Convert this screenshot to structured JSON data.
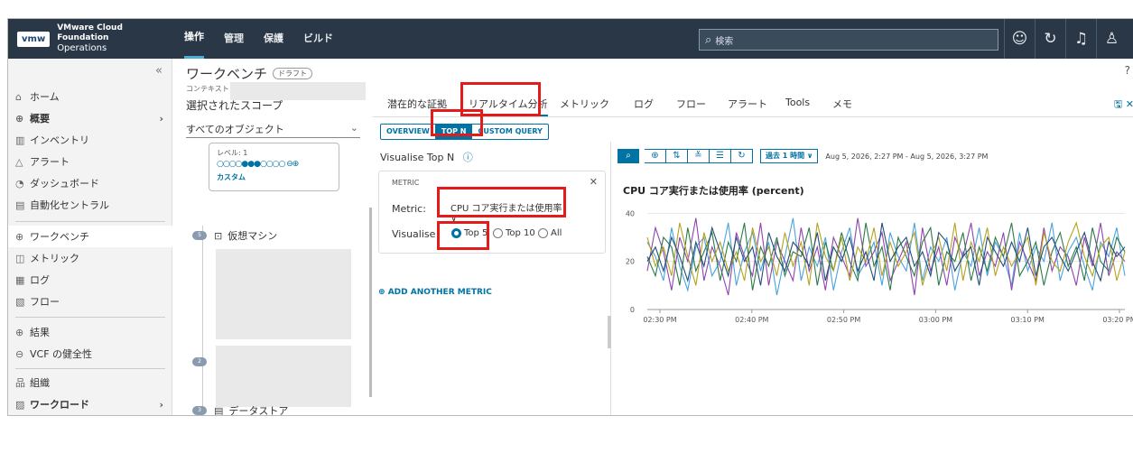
{
  "brand": {
    "logo": "vmw",
    "line1": "VMware Cloud Foundation",
    "line2": "Operations"
  },
  "topnav": [
    "操作",
    "管理",
    "保護",
    "ビルド"
  ],
  "search": {
    "placeholder": "検索"
  },
  "header_icons": [
    "smiley-icon",
    "refresh-icon",
    "bell-icon",
    "user-icon"
  ],
  "sidebar": {
    "collapse": "«",
    "items": [
      {
        "label": "ホーム",
        "icon": "⌂"
      },
      {
        "label": "概要",
        "icon": "⊕",
        "chev": "›"
      },
      {
        "label": "インベントリ",
        "icon": "▥"
      },
      {
        "label": "アラート",
        "icon": "△"
      },
      {
        "label": "ダッシュボード",
        "icon": "◔"
      },
      {
        "label": "自動化セントラル",
        "icon": "▤"
      },
      {
        "label": "ワークベンチ",
        "icon": "⊕"
      },
      {
        "label": "メトリック",
        "icon": "◫"
      },
      {
        "label": "ログ",
        "icon": "▦"
      },
      {
        "label": "フロー",
        "icon": "▧"
      },
      {
        "label": "結果",
        "icon": "⊕"
      },
      {
        "label": "VCF の健全性",
        "icon": "⊖"
      },
      {
        "label": "組織",
        "icon": "品"
      },
      {
        "label": "ワークロード",
        "icon": "▨",
        "chev": "›"
      }
    ]
  },
  "panel": {
    "title": "ワークベンチ",
    "draft": "ドラフト",
    "context_label": "コンテキスト",
    "scope_label": "選択されたスコープ",
    "all_objects": "すべてのオブジェクト",
    "level": "レベル: 1",
    "level_dots": "○○○○●●●○○○○ ⊖⊕",
    "custom": "カスタム",
    "tree": [
      {
        "badge": "5",
        "label": "仮想マシン",
        "icon": "⊡"
      },
      {
        "badge": "2",
        "label": "",
        "icon": ""
      },
      {
        "badge": "3",
        "label": "データストア",
        "icon": "▤"
      }
    ]
  },
  "main": {
    "help": "?",
    "tabs": [
      "潜在的な証拠",
      "リアルタイム分析",
      "メトリック",
      "ログ",
      "フロー",
      "アラート",
      "Tools",
      "メモ"
    ],
    "tab_icons": "🖫 ✕",
    "modes": [
      "OVERVIEW",
      "TOP N",
      "CUSTOM QUERY"
    ],
    "visualise_title": "Visualise Top N",
    "metric_header": "METRIC",
    "metric_label": "Metric:",
    "metric_value": "CPU コア実行または使用率",
    "visualise_label": "Visualise",
    "options": [
      "Top 5",
      "Top 10",
      "All"
    ],
    "add_metric": "ADD ANOTHER METRIC",
    "time_button": "過去 1 時間 ∨",
    "time_range": "Aug 5, 2026, 2:27 PM - Aug 5, 2026, 3:27 PM"
  },
  "chart_data": {
    "type": "line",
    "title": "CPU コア実行または使用率 (percent)",
    "ylim": [
      0,
      45
    ],
    "yticks": [
      0,
      20,
      40
    ],
    "xticks": [
      "02:30 PM",
      "02:40 PM",
      "02:50 PM",
      "03:00 PM",
      "03:10 PM",
      "03:20 PM"
    ],
    "series_colors": [
      "#4aa3df",
      "#8e44ad",
      "#2c7a45",
      "#b5a21d",
      "#1f4e79"
    ],
    "series": [
      {
        "values": [
          28,
          22,
          12,
          34,
          18,
          8,
          26,
          30,
          14,
          20,
          36,
          10,
          24,
          32,
          16,
          28,
          6,
          22,
          38,
          12,
          26,
          18,
          30,
          8,
          24,
          34,
          14,
          20,
          28,
          10,
          32,
          22,
          16,
          36,
          12,
          26,
          20,
          30,
          8,
          24,
          18,
          34,
          14,
          28,
          22,
          10,
          32,
          16,
          26,
          20,
          36,
          12,
          24,
          30,
          18,
          8,
          28,
          22,
          34,
          14
        ]
      },
      {
        "values": [
          16,
          34,
          24,
          8,
          30,
          20,
          38,
          12,
          26,
          18,
          6,
          32,
          22,
          14,
          36,
          10,
          28,
          20,
          12,
          34,
          16,
          26,
          8,
          30,
          22,
          14,
          38,
          18,
          24,
          32,
          12,
          20,
          28,
          6,
          34,
          16,
          26,
          10,
          30,
          22,
          36,
          14,
          24,
          18,
          32,
          8,
          28,
          20,
          12,
          34,
          16,
          26,
          22,
          10,
          30,
          18,
          36,
          14,
          24,
          20
        ]
      },
      {
        "values": [
          22,
          14,
          30,
          26,
          10,
          34,
          16,
          24,
          32,
          12,
          28,
          20,
          36,
          8,
          26,
          18,
          30,
          14,
          24,
          22,
          34,
          10,
          28,
          16,
          32,
          20,
          12,
          36,
          18,
          26,
          8,
          30,
          22,
          14,
          28,
          34,
          10,
          24,
          20,
          32,
          12,
          26,
          16,
          30,
          22,
          36,
          14,
          20,
          28,
          10,
          24,
          32,
          18,
          26,
          12,
          34,
          20,
          16,
          30,
          24
        ]
      },
      {
        "values": [
          30,
          18,
          26,
          14,
          36,
          22,
          10,
          32,
          20,
          28,
          16,
          24,
          12,
          34,
          20,
          26,
          14,
          32,
          18,
          28,
          10,
          36,
          22,
          16,
          30,
          12,
          26,
          20,
          34,
          14,
          28,
          18,
          24,
          32,
          10,
          22,
          30,
          16,
          36,
          12,
          28,
          20,
          34,
          14,
          26,
          18,
          24,
          30,
          10,
          32,
          20,
          16,
          28,
          36,
          22,
          14,
          26,
          30,
          12,
          24
        ]
      },
      {
        "values": [
          20,
          26,
          16,
          30,
          22,
          12,
          28,
          18,
          34,
          24,
          14,
          30,
          20,
          26,
          10,
          32,
          22,
          16,
          28,
          24,
          18,
          32,
          12,
          26,
          20,
          30,
          16,
          24,
          12,
          36,
          20,
          26,
          30,
          18,
          24,
          14,
          32,
          28,
          16,
          22,
          26,
          10,
          30,
          24,
          18,
          28,
          20,
          34,
          14,
          26,
          30,
          22,
          16,
          24,
          32,
          20,
          12,
          28,
          22,
          26
        ]
      }
    ]
  },
  "highlight_color": "#e31b1b"
}
